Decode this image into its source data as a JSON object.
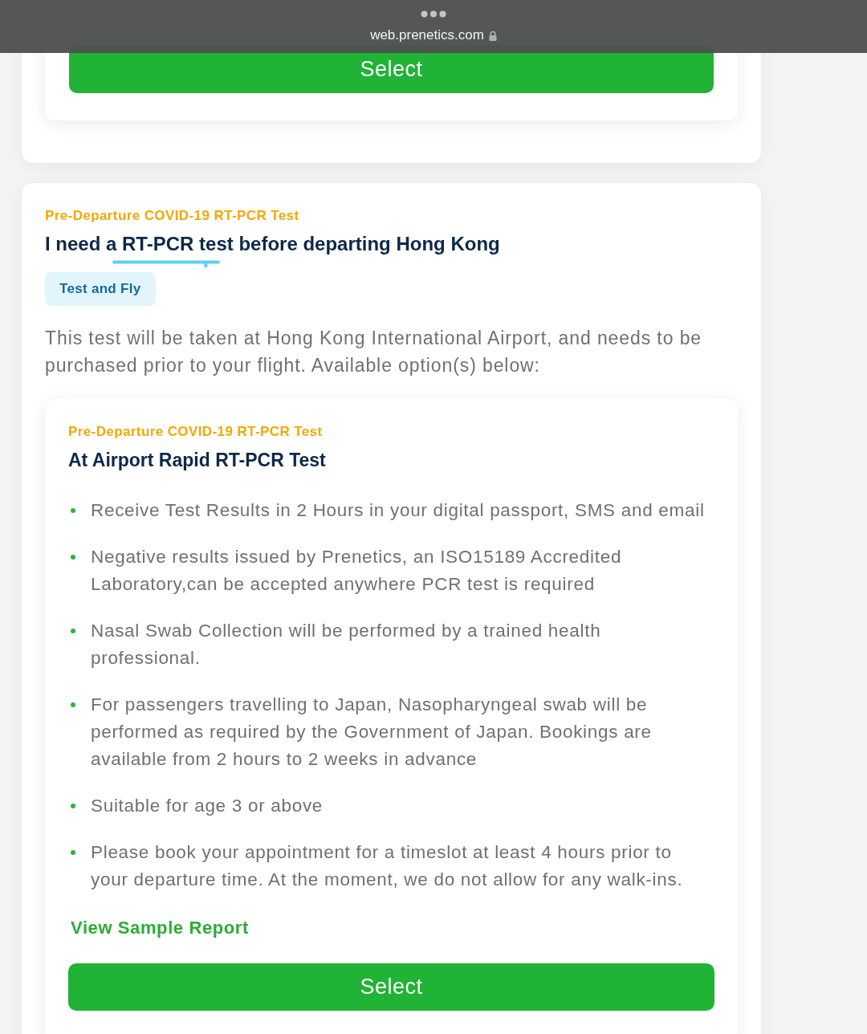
{
  "browser_bar": {
    "url": "web.prenetics.com"
  },
  "previous_option": {
    "button": "Select"
  },
  "section": {
    "eyebrow": "Pre-Departure COVID-19 RT-PCR Test",
    "title": "I need a RT-PCR test before departing Hong Kong",
    "tag": "Test and Fly",
    "description": "This test will be taken at Hong Kong International Airport, and needs to be purchased prior to your flight. Available option(s) below:",
    "option": {
      "eyebrow": "Pre-Departure COVID-19 RT-PCR Test",
      "title": "At Airport Rapid RT-PCR Test",
      "features": [
        "Receive Test Results in 2 Hours in your digital passport, SMS and email",
        "Negative results issued by Prenetics, an ISO15189 Accredited Laboratory,can be accepted anywhere PCR test is required",
        "Nasal Swab Collection will be performed by a trained health professional.",
        "For passengers travelling to Japan, Nasopharyngeal swab will be performed as required by the Government of Japan. Bookings are available from 2 hours to 2 weeks in advance",
        "Suitable for age 3 or above",
        "Please book your appointment for a timeslot at least 4 hours prior to your departure time. At the moment, we do not allow for any walk-ins."
      ],
      "link": "View Sample Report",
      "button": "Select"
    }
  }
}
